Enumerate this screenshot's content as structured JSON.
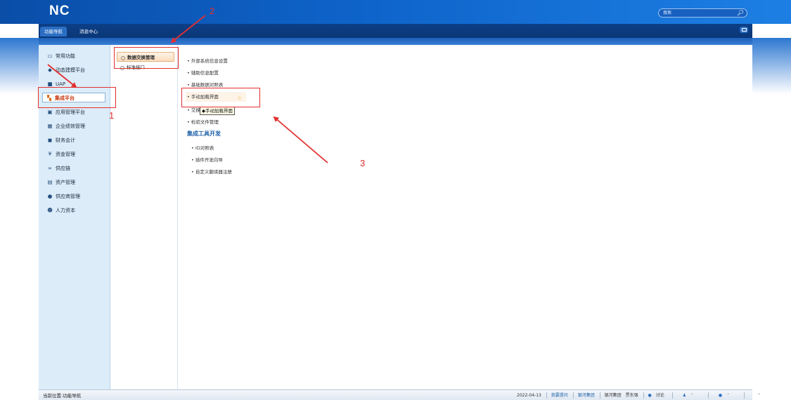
{
  "header": {
    "logo": "NC",
    "search": {
      "placeholder": "搜索"
    }
  },
  "tabs": [
    {
      "label": "功能导航",
      "active": true
    },
    {
      "label": "消息中心",
      "active": false
    }
  ],
  "sidebar": {
    "items": [
      {
        "label": "常用功能",
        "icon": "monitor-icon"
      },
      {
        "label": "动态建模平台",
        "icon": "cube-icon"
      },
      {
        "label": "UAP",
        "icon": "box-icon"
      },
      {
        "label": "集成平台",
        "icon": "integration-icon",
        "active": true
      },
      {
        "label": "应用管理平台",
        "icon": "app-icon"
      },
      {
        "label": "企业绩效管理",
        "icon": "grid-icon"
      },
      {
        "label": "财务会计",
        "icon": "finance-icon"
      },
      {
        "label": "资金管理",
        "icon": "yen-icon"
      },
      {
        "label": "供应链",
        "icon": "link-icon"
      },
      {
        "label": "资产管理",
        "icon": "asset-icon"
      },
      {
        "label": "供应商管理",
        "icon": "supplier-icon"
      },
      {
        "label": "人力资本",
        "icon": "people-icon"
      }
    ]
  },
  "submenu": {
    "items": [
      {
        "label": "数据交换管理",
        "active": true
      },
      {
        "label": "标准接口"
      }
    ]
  },
  "functions": {
    "items": [
      "外部系统信息设置",
      "辅助信息配置",
      "基础数据对照表",
      "手动加载界面",
      "交换",
      "检验文件管理"
    ],
    "section_title": "集成工具开发",
    "section_items": [
      "ID对照表",
      "插件开发向导",
      "自定义翻译器注册"
    ],
    "tooltip": "◆手动加载界面"
  },
  "annotations": {
    "one": "1",
    "two": "2",
    "three": "3",
    "color": "#e23030"
  },
  "statusbar": {
    "location": "当前位置:功能导航",
    "date": "2022-04-13",
    "links": [
      "我要提问",
      "银河集团",
      "银河集团",
      "贾东强"
    ],
    "discuss": "讨论"
  }
}
